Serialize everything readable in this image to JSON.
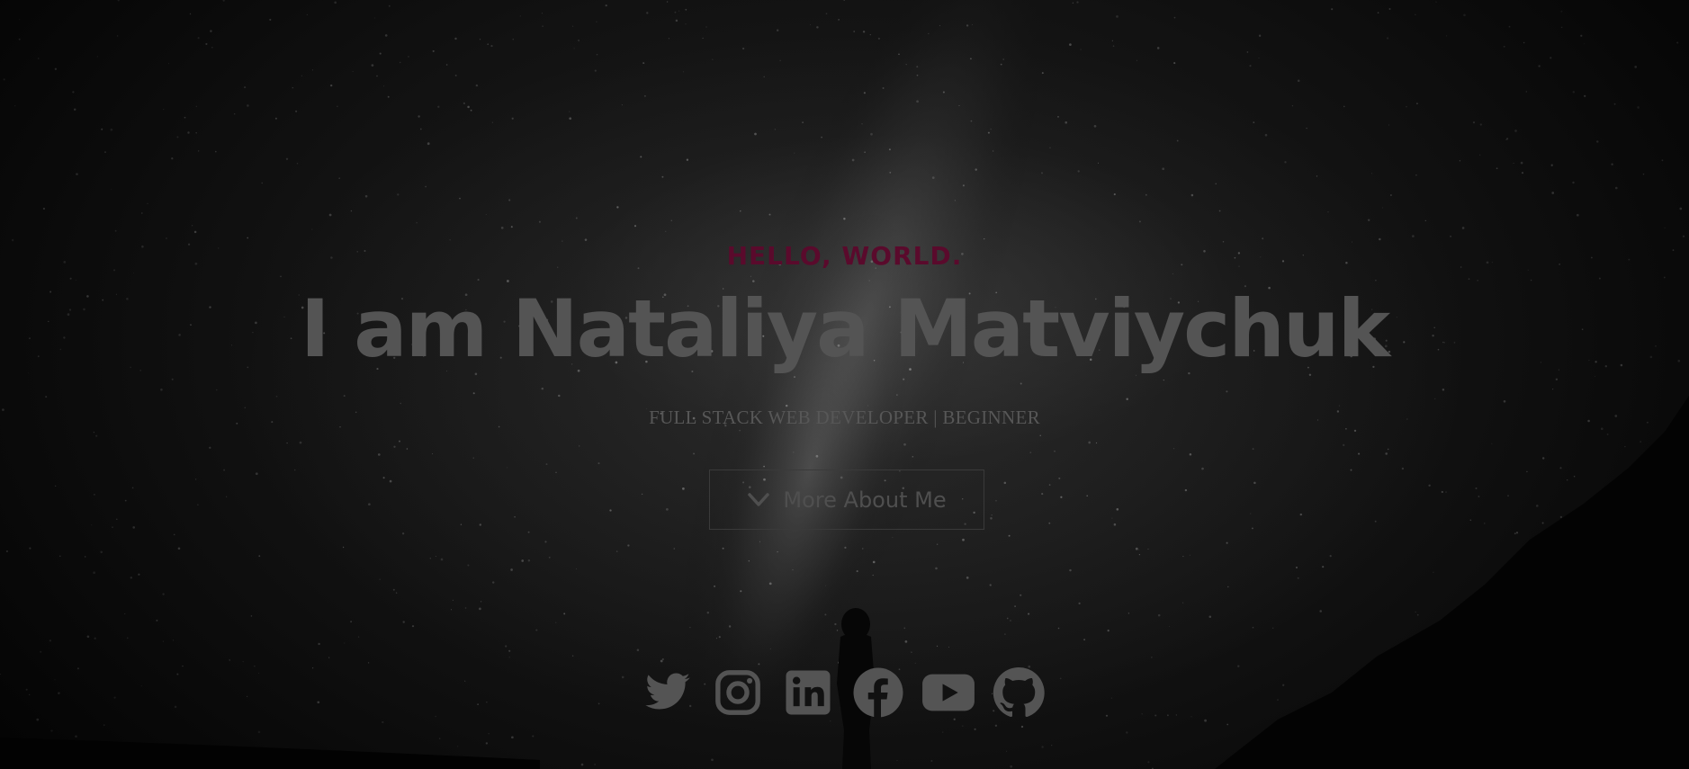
{
  "hero": {
    "greeting": "HELLO, WORLD.",
    "name": "I am Nataliya Matviychuk",
    "subtitle": "FULL STACK WEB DEVELOPER | BEGINNER",
    "button_label": "More About Me",
    "button_icon": "chevron-down-icon"
  },
  "social": [
    {
      "icon": "twitter-icon"
    },
    {
      "icon": "instagram-icon"
    },
    {
      "icon": "linkedin-icon"
    },
    {
      "icon": "facebook-icon"
    },
    {
      "icon": "youtube-icon"
    },
    {
      "icon": "github-icon"
    }
  ],
  "colors": {
    "greeting": "#5a0a2c",
    "name": "#545454",
    "text_muted": "#575757",
    "icon": "#545454",
    "background": "#000000"
  }
}
